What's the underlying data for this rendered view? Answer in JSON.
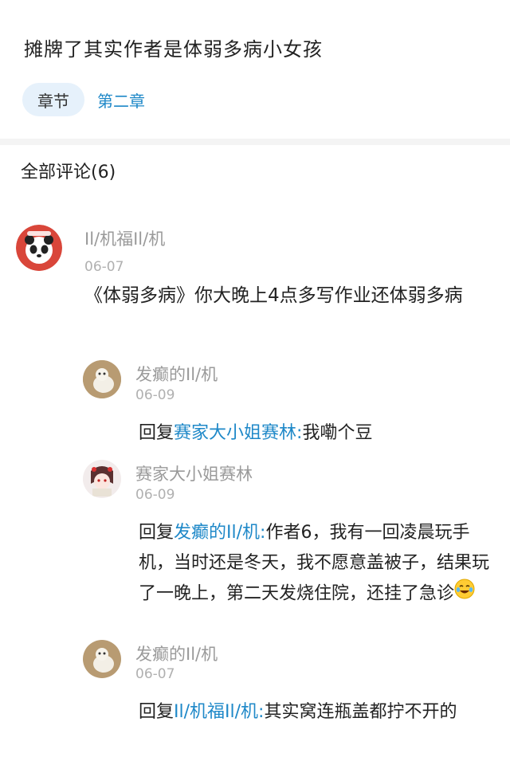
{
  "post": {
    "title": "摊牌了其实作者是体弱多病小女孩",
    "chapter_label": "章节",
    "chapter_link": "第二章"
  },
  "comments_header": "全部评论(6)",
  "comment": {
    "author": "Il/机福Il/机",
    "date": "06-07",
    "text": "《体弱多病》你大晚上4点多写作业还体弱多病"
  },
  "replies": [
    {
      "author": "发癫的Il/机",
      "date": "06-09",
      "prefix": "回复",
      "mention": "赛家大小姐赛林",
      "colon": ":",
      "text": "我嘞个豆"
    },
    {
      "author": "赛家大小姐赛林",
      "date": "06-09",
      "prefix": "回复",
      "mention": "发癫的Il/机",
      "colon": ":",
      "text": "作者6，我有一回凌晨玩手机，当时还是冬天，我不愿意盖被子，结果玩了一晚上，第二天发烧住院，还挂了急诊",
      "emoji": "tears-of-joy-emoji"
    },
    {
      "author": "发癫的Il/机",
      "date": "06-07",
      "prefix": "回复",
      "mention": "Il/机福Il/机",
      "colon": ":",
      "text": "其实窝连瓶盖都拧不开的"
    }
  ],
  "colors": {
    "accent": "#1e88c8",
    "chip_bg": "#e6f1fb",
    "meta": "#9a9a9a"
  }
}
